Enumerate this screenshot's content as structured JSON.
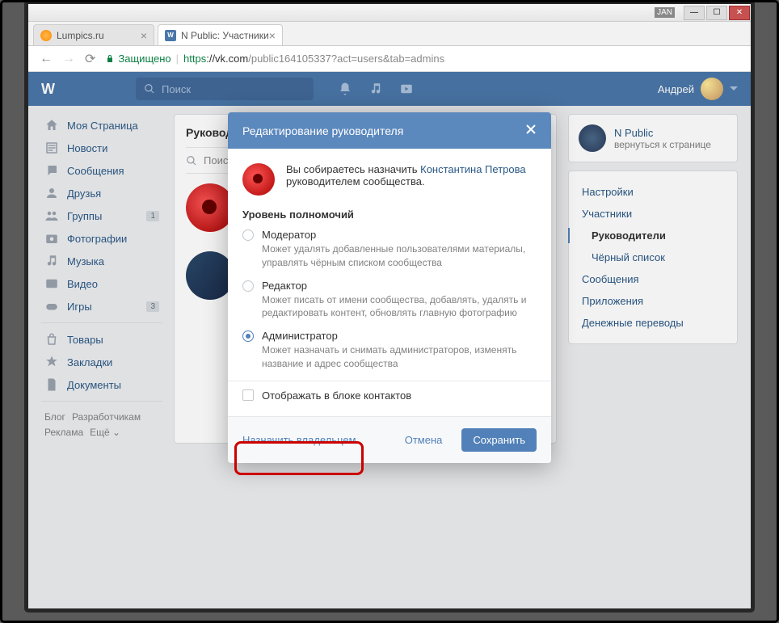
{
  "window": {
    "lang_indicator": "JAN"
  },
  "browser": {
    "tabs": [
      {
        "title": "Lumpics.ru"
      },
      {
        "title": "N Public: Участники"
      }
    ],
    "secure_label": "Защищено",
    "url_proto": "https",
    "url_host": "://vk.com",
    "url_path": "/public164105337?act=users&tab=admins"
  },
  "vk": {
    "search_placeholder": "Поиск",
    "user_name": "Андрей",
    "left_nav": {
      "my_page": "Моя Страница",
      "news": "Новости",
      "messages": "Сообщения",
      "friends": "Друзья",
      "groups": "Группы",
      "groups_badge": "1",
      "photos": "Фотографии",
      "music": "Музыка",
      "videos": "Видео",
      "games": "Игры",
      "games_badge": "3",
      "market": "Товары",
      "bookmarks": "Закладки",
      "docs": "Документы"
    },
    "footer": {
      "blog": "Блог",
      "devs": "Разработчикам",
      "ads": "Реклама",
      "more": "Ещё ⌄"
    },
    "main": {
      "heading": "Руководи",
      "search_placeholder": "Поис"
    },
    "right": {
      "community_title": "N Public",
      "community_sub": "вернуться к странице",
      "menu": {
        "settings": "Настройки",
        "members": "Участники",
        "managers": "Руководители",
        "blacklist": "Чёрный список",
        "messages": "Сообщения",
        "apps": "Приложения",
        "money": "Денежные переводы"
      }
    }
  },
  "modal": {
    "title": "Редактирование руководителя",
    "intro_prefix": "Вы собираетесь назначить ",
    "intro_user": "Константина Петрова",
    "intro_suffix": " руководителем сообщества.",
    "level_heading": "Уровень полномочий",
    "roles": {
      "moderator": {
        "label": "Модератор",
        "desc": "Может удалять добавленные пользователями материалы, управлять чёрным списком сообщества"
      },
      "editor": {
        "label": "Редактор",
        "desc": "Может писать от имени сообщества, добавлять, удалять и редактировать контент, обновлять главную фотографию"
      },
      "admin": {
        "label": "Администратор",
        "desc": "Может назначать и снимать администраторов, изменять название и адрес сообщества"
      }
    },
    "show_in_contacts": "Отображать в блоке контактов",
    "assign_owner": "Назначить владельцем",
    "cancel": "Отмена",
    "save": "Сохранить"
  }
}
